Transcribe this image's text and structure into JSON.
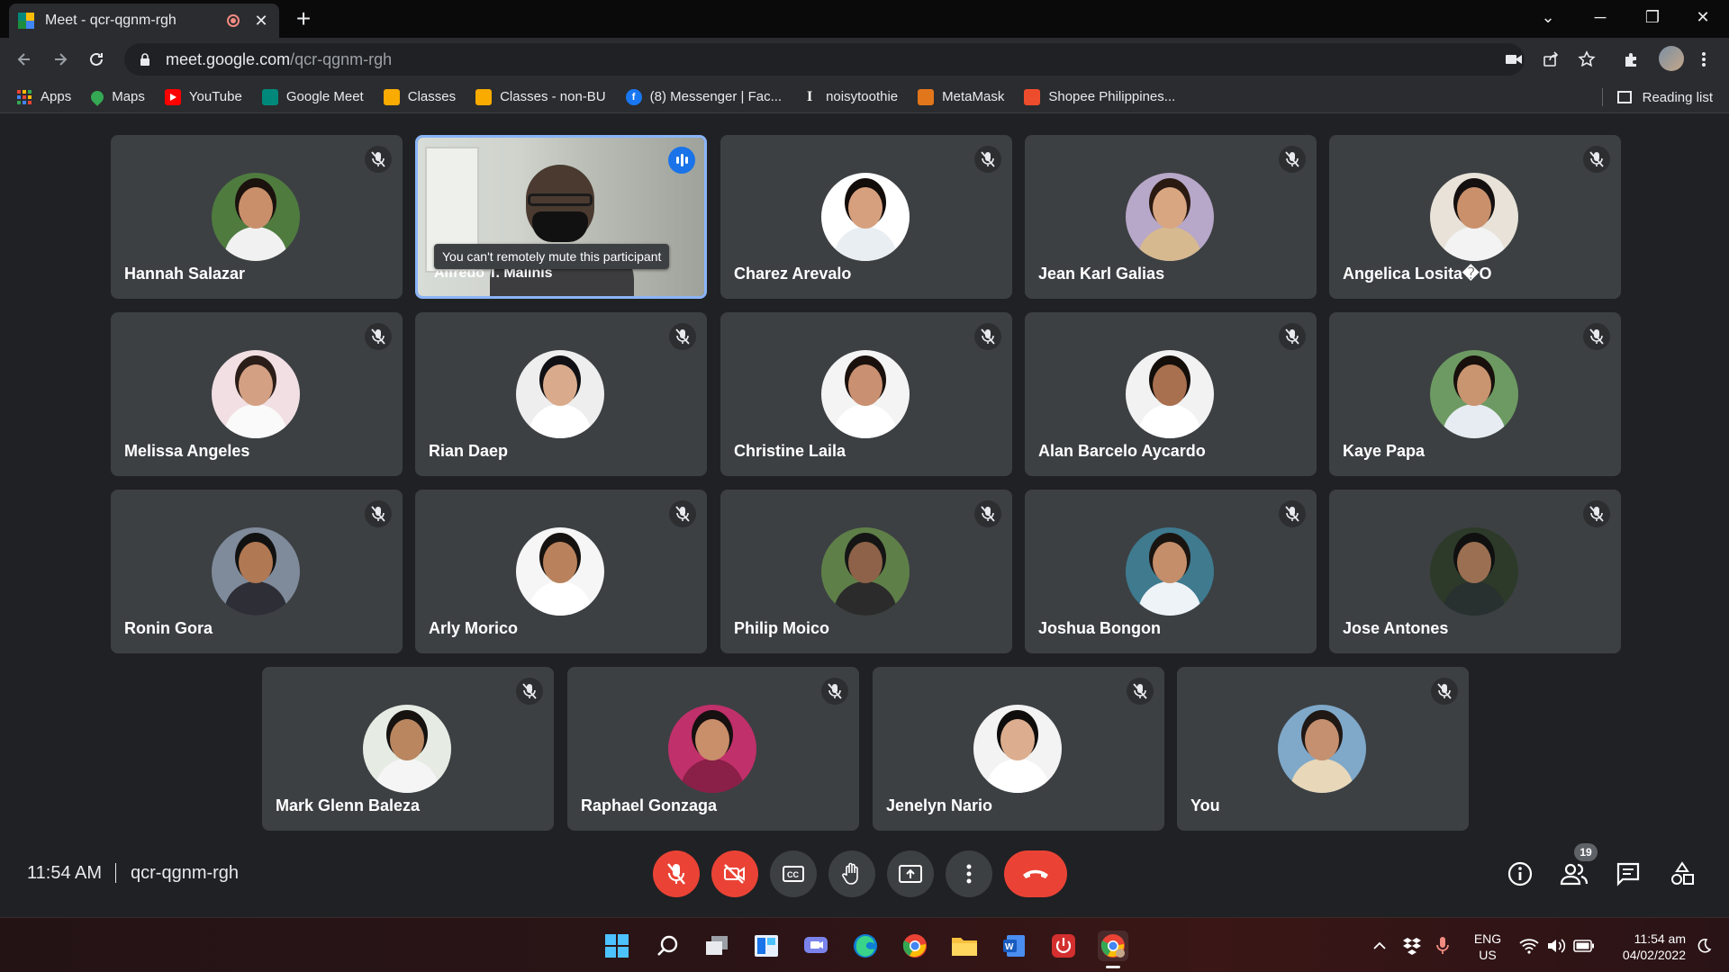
{
  "browser": {
    "tab_title": "Meet - qcr-qgnm-rgh",
    "tab_close": "✕",
    "new_tab": "+",
    "url_host": "meet.google.com",
    "url_path": "/qcr-qgnm-rgh",
    "window_controls": {
      "dropdown": "⌄",
      "minimize": "─",
      "restore": "❐",
      "close": "✕"
    },
    "bookmarks": [
      {
        "label": "Apps",
        "icon": "apps-grid-icon",
        "color": "#ea4335"
      },
      {
        "label": "Maps",
        "icon": "maps-pin-icon",
        "color": "#34a853"
      },
      {
        "label": "YouTube",
        "icon": "youtube-icon",
        "color": "#ff0000"
      },
      {
        "label": "Google Meet",
        "icon": "meet-icon",
        "color": "#00897b"
      },
      {
        "label": "Classes",
        "icon": "classroom-icon",
        "color": "#f9ab00"
      },
      {
        "label": "Classes - non-BU",
        "icon": "classroom-icon",
        "color": "#f9ab00"
      },
      {
        "label": "(8) Messenger | Fac...",
        "icon": "facebook-icon",
        "color": "#1877f2"
      },
      {
        "label": "noisytoothie",
        "icon": "text-cursor-icon",
        "color": "#2b2c2f"
      },
      {
        "label": "MetaMask",
        "icon": "metamask-fox-icon",
        "color": "#e2761b"
      },
      {
        "label": "Shopee Philippines...",
        "icon": "shopee-bag-icon",
        "color": "#ee4d2d"
      }
    ],
    "reading_list": "Reading list"
  },
  "meet": {
    "tooltip": "You can't remotely mute this participant",
    "participants": [
      {
        "name": "Hannah Salazar",
        "bg": "#4f7b3f",
        "skin": "#c98f6b",
        "shirt": "#f1f1f1",
        "hair": "#1b120e"
      },
      {
        "name": "Alfredo T. Malinis",
        "video": true
      },
      {
        "name": "Charez Arevalo",
        "bg": "#ffffff",
        "skin": "#d6a07e",
        "shirt": "#e9eef3",
        "hair": "#120c0a"
      },
      {
        "name": "Jean Karl Galias",
        "bg": "#b7a7c8",
        "skin": "#d9a682",
        "shirt": "#d6b98f",
        "hair": "#2a1a12"
      },
      {
        "name": "Angelica Losita�O",
        "bg": "#e8e2d8",
        "skin": "#c9906b",
        "shirt": "#f3f3f3",
        "hair": "#151010"
      },
      {
        "name": "Melissa Angeles",
        "bg": "#f1dfe3",
        "skin": "#d3a083",
        "shirt": "#fafafa",
        "hair": "#2b1d18"
      },
      {
        "name": "Rian Daep",
        "bg": "#eeeeee",
        "skin": "#d9ab8c",
        "shirt": "#ffffff",
        "hair": "#101014"
      },
      {
        "name": "Christine Laila",
        "bg": "#f4f4f4",
        "skin": "#c99072",
        "shirt": "#ffffff",
        "hair": "#1a110d"
      },
      {
        "name": "Alan Barcelo Aycardo",
        "bg": "#f2f2f2",
        "skin": "#a8704e",
        "shirt": "#ffffff",
        "hair": "#140e0b"
      },
      {
        "name": "Kaye Papa",
        "bg": "#6d9a62",
        "skin": "#c99470",
        "shirt": "#e6ecf2",
        "hair": "#17100c"
      },
      {
        "name": "Ronin Gora",
        "bg": "#7f8a9a",
        "skin": "#b07853",
        "shirt": "#2e2e36",
        "hair": "#111"
      },
      {
        "name": "Arly Morico",
        "bg": "#f6f6f6",
        "skin": "#b9825c",
        "shirt": "#ffffff",
        "hair": "#161210"
      },
      {
        "name": "Philip Moico",
        "bg": "#5f7f48",
        "skin": "#8d6248",
        "shirt": "#2b2b2b",
        "hair": "#151515"
      },
      {
        "name": "Joshua Bongon",
        "bg": "#3f7a8f",
        "skin": "#c48e6a",
        "shirt": "#eef3f8",
        "hair": "#1a1410"
      },
      {
        "name": "Jose Antones",
        "bg": "#2d3a2a",
        "skin": "#9b6f52",
        "shirt": "#283030",
        "hair": "#101010"
      },
      {
        "name": "Mark Glenn Baleza",
        "bg": "#e6ece4",
        "skin": "#b98660",
        "shirt": "#f5f5f5",
        "hair": "#151210"
      },
      {
        "name": "Raphael Gonzaga",
        "bg": "#c0306a",
        "skin": "#c98e6a",
        "shirt": "#8a1f47",
        "hair": "#161010"
      },
      {
        "name": "Jenelyn Nario",
        "bg": "#f3f3f3",
        "skin": "#dcae8f",
        "shirt": "#ffffff",
        "hair": "#0f0c0c"
      },
      {
        "name": "You",
        "bg": "#7fa8c9",
        "skin": "#c49070",
        "shirt": "#e8d7b9",
        "hair": "#201814"
      }
    ],
    "clock": "11:54 AM",
    "separator": "|",
    "meeting_code": "qcr-qgnm-rgh",
    "participant_count": "19"
  },
  "taskbar": {
    "lang_top": "ENG",
    "lang_bottom": "US",
    "time": "11:54 am",
    "date": "04/02/2022"
  }
}
